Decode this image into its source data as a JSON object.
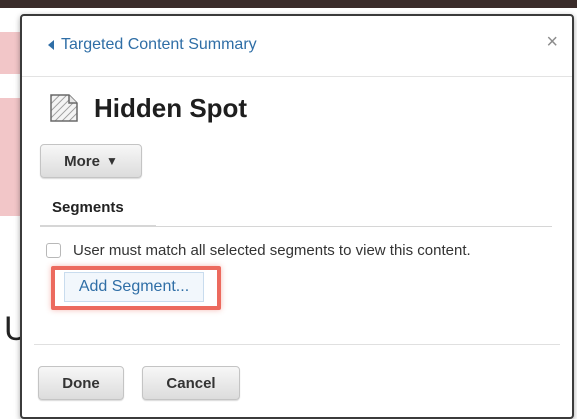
{
  "header": {
    "back_link_label": "Targeted Content Summary",
    "close_glyph": "×"
  },
  "content": {
    "title": "Hidden Spot",
    "title_icon": "document-hidden-icon"
  },
  "toolbar": {
    "more_label": "More",
    "more_caret": "▼"
  },
  "tabs": [
    {
      "label": "Segments",
      "active": true
    }
  ],
  "segments": {
    "match_all_label": "User must match all selected segments to view this content.",
    "match_all_checked": false,
    "add_segment_label": "Add Segment...",
    "highlight_color": "#ec6a5e"
  },
  "footer": {
    "done_label": "Done",
    "cancel_label": "Cancel"
  },
  "background": {
    "partial_glyph": "U"
  }
}
